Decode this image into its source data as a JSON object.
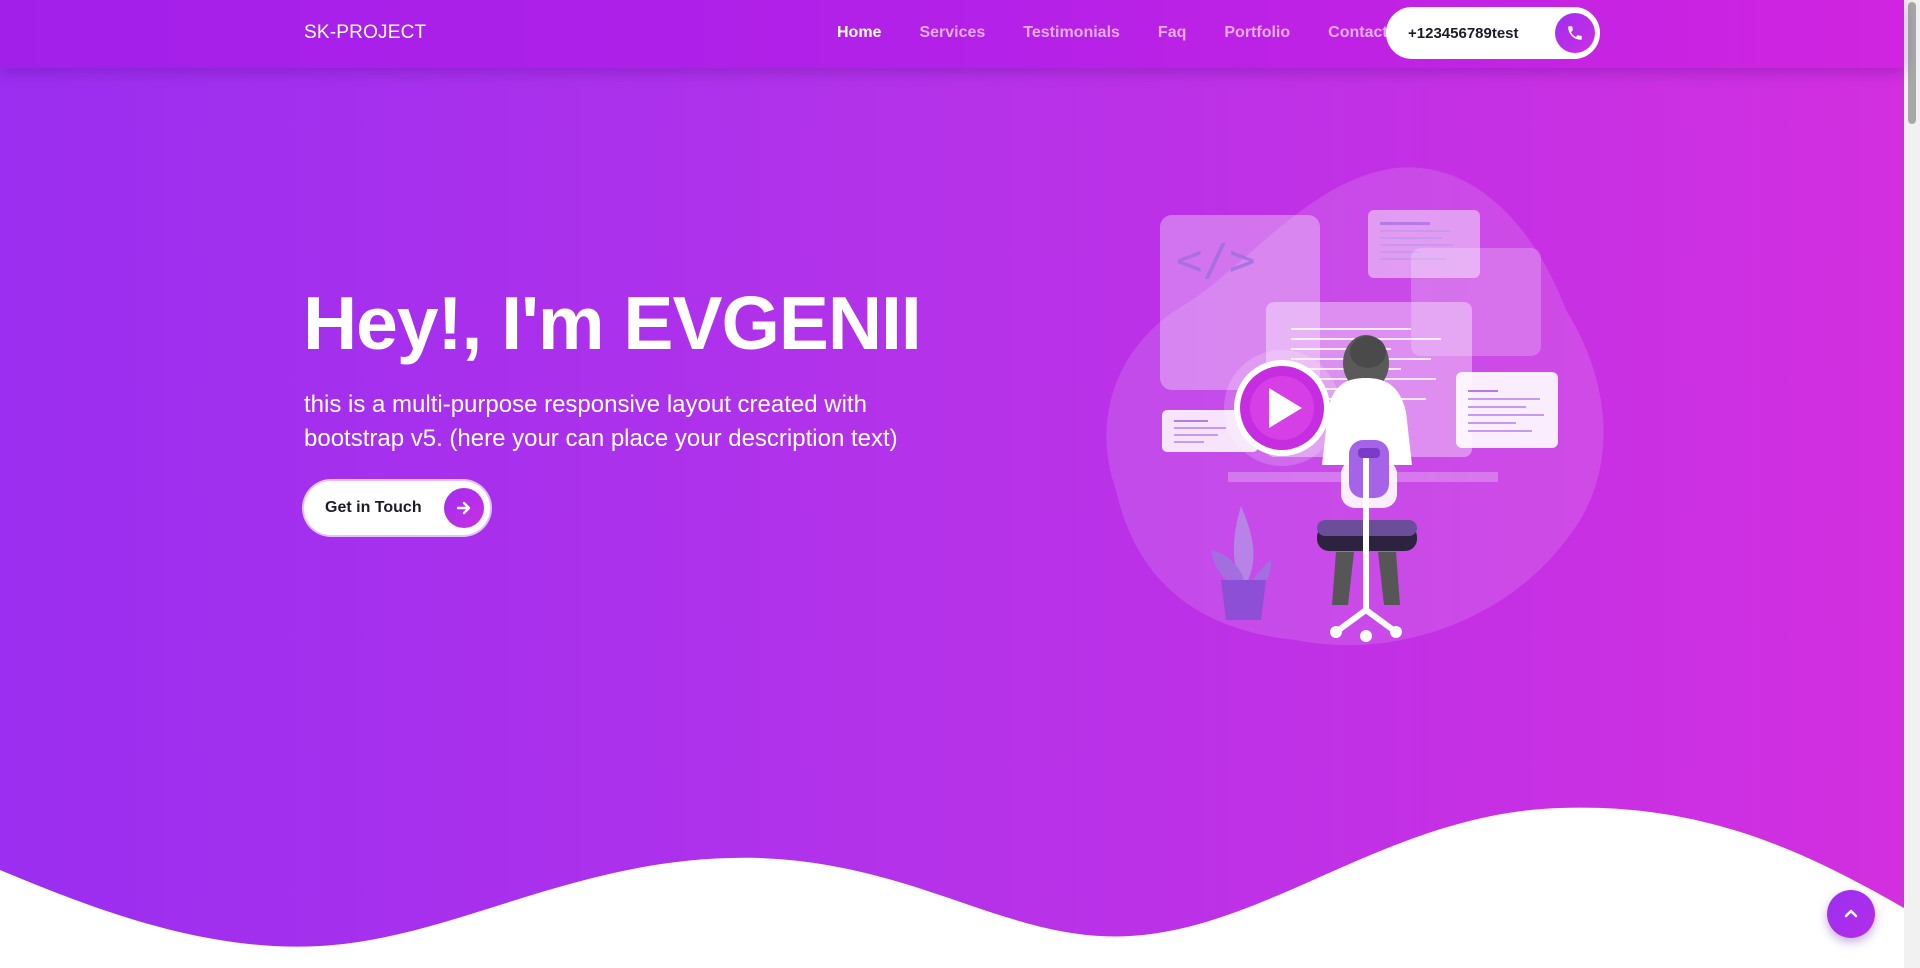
{
  "brand": "SK-PROJECT",
  "nav": {
    "items": [
      {
        "label": "Home",
        "active": true
      },
      {
        "label": "Services",
        "active": false
      },
      {
        "label": "Testimonials",
        "active": false
      },
      {
        "label": "Faq",
        "active": false
      },
      {
        "label": "Portfolio",
        "active": false
      },
      {
        "label": "Contact",
        "active": false
      }
    ],
    "phone": "+123456789test",
    "phone_icon": "phone-icon"
  },
  "hero": {
    "title": "Hey!, I'm EVGENII",
    "description": "this is a multi-purpose responsive layout created with bootstrap v5. (here your can place your description text)",
    "cta_label": "Get in Touch",
    "cta_icon": "arrow-right-icon",
    "illustration_code_tag": "</>"
  },
  "scroll_top_icon": "chevron-up-icon",
  "colors": {
    "gradient_start": "#9b2ef0",
    "gradient_end": "#d22fe0",
    "accent": "#a12ef0",
    "background": "#ffffff"
  }
}
